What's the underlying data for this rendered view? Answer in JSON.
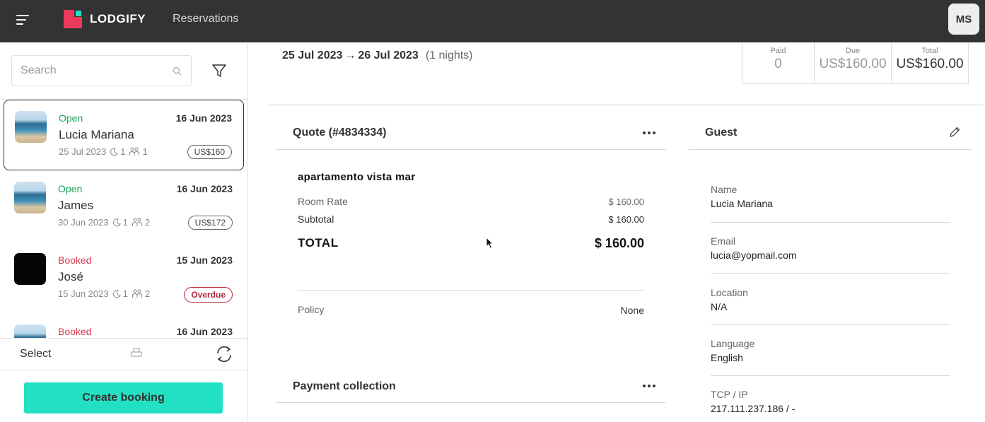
{
  "header": {
    "brand": "LODGIFY",
    "nav_link": "Reservations",
    "avatar_initials": "MS",
    "brand_color": "#ee3a5a",
    "accent_color": "#22e0c3"
  },
  "sidebar": {
    "search_placeholder": "Search",
    "reservations": [
      {
        "status": "Open",
        "status_type": "open",
        "date": "16 Jun 2023",
        "name": "Lucia Mariana",
        "checkin": "25 Jul 2023",
        "nights": "1",
        "guests": "1",
        "badge": "US$160",
        "badge_type": "price",
        "thumb": "beach"
      },
      {
        "status": "Open",
        "status_type": "open",
        "date": "16 Jun 2023",
        "name": "James",
        "checkin": "30 Jun 2023",
        "nights": "1",
        "guests": "2",
        "badge": "US$172",
        "badge_type": "price",
        "thumb": "beach"
      },
      {
        "status": "Booked",
        "status_type": "booked",
        "date": "15 Jun 2023",
        "name": "José",
        "checkin": "15 Jun 2023",
        "nights": "1",
        "guests": "2",
        "badge": "Overdue",
        "badge_type": "overdue",
        "thumb": "dark"
      },
      {
        "status": "Booked",
        "status_type": "booked",
        "date": "16 Jun 2023",
        "thumb": "beach"
      }
    ],
    "select_label": "Select",
    "create_button": "Create booking"
  },
  "main": {
    "date_from": "25 Jul 2023",
    "arrow": "→",
    "date_to": "26 Jul 2023",
    "nights_text": "(1 nights)",
    "summary": [
      {
        "label": "Paid",
        "value": "0"
      },
      {
        "label": "Due",
        "value": "US$160.00"
      },
      {
        "label": "Total",
        "value": "US$160.00"
      }
    ],
    "quote": {
      "title": "Quote (#4834334)",
      "property_name": "apartamento vista mar",
      "room_rate_label": "Room Rate",
      "room_rate_value": "$ 160.00",
      "subtotal_label": "Subtotal",
      "subtotal_value": "$ 160.00",
      "total_label": "TOTAL",
      "total_value": "$ 160.00",
      "policy_label": "Policy",
      "policy_value": "None"
    },
    "payment_collection_title": "Payment collection",
    "guest": {
      "title": "Guest",
      "fields": [
        {
          "label": "Name",
          "value": "Lucia Mariana"
        },
        {
          "label": "Email",
          "value": "lucia@yopmail.com"
        },
        {
          "label": "Location",
          "value": "N/A"
        },
        {
          "label": "Language",
          "value": "English"
        },
        {
          "label": "TCP / IP",
          "value": "217.111.237.186 / -"
        }
      ]
    }
  }
}
